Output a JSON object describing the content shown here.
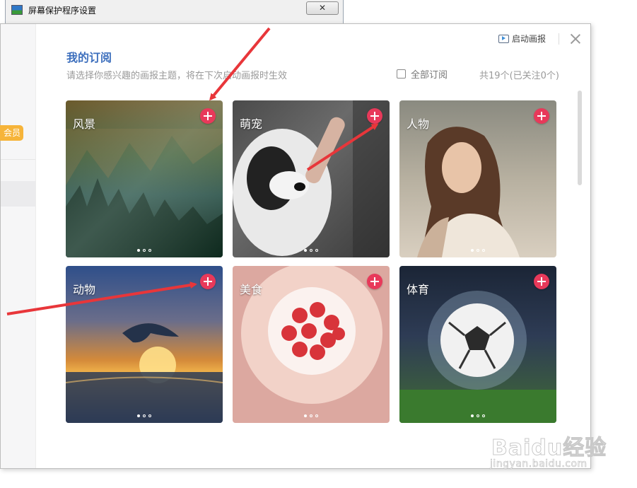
{
  "background_window": {
    "title": "屏幕保护程序设置",
    "close_glyph": "✕"
  },
  "sidebar": {
    "vip_label": "会员"
  },
  "topbar": {
    "start_label": "启动画报"
  },
  "header": {
    "title": "我的订阅",
    "hint": "请选择你感兴趣的画报主题，将在下次启动画报时生效",
    "subscribe_all": "全部订阅",
    "count": "共19个(已关注0个)"
  },
  "cards": [
    {
      "label": "风景"
    },
    {
      "label": "萌宠"
    },
    {
      "label": "人物"
    },
    {
      "label": "动物"
    },
    {
      "label": "美食"
    },
    {
      "label": "体育"
    }
  ],
  "watermark": {
    "brand": "Baidu经验",
    "url": "jingyan.baidu.com"
  },
  "colors": {
    "accent_blue": "#3d6fbd",
    "add_button_red": "#e8395a",
    "vip_orange": "#f6b43a",
    "annotation_arrow": "#e8363a"
  },
  "carousel": {
    "dots_per_card": 3,
    "active_dot": 1
  }
}
